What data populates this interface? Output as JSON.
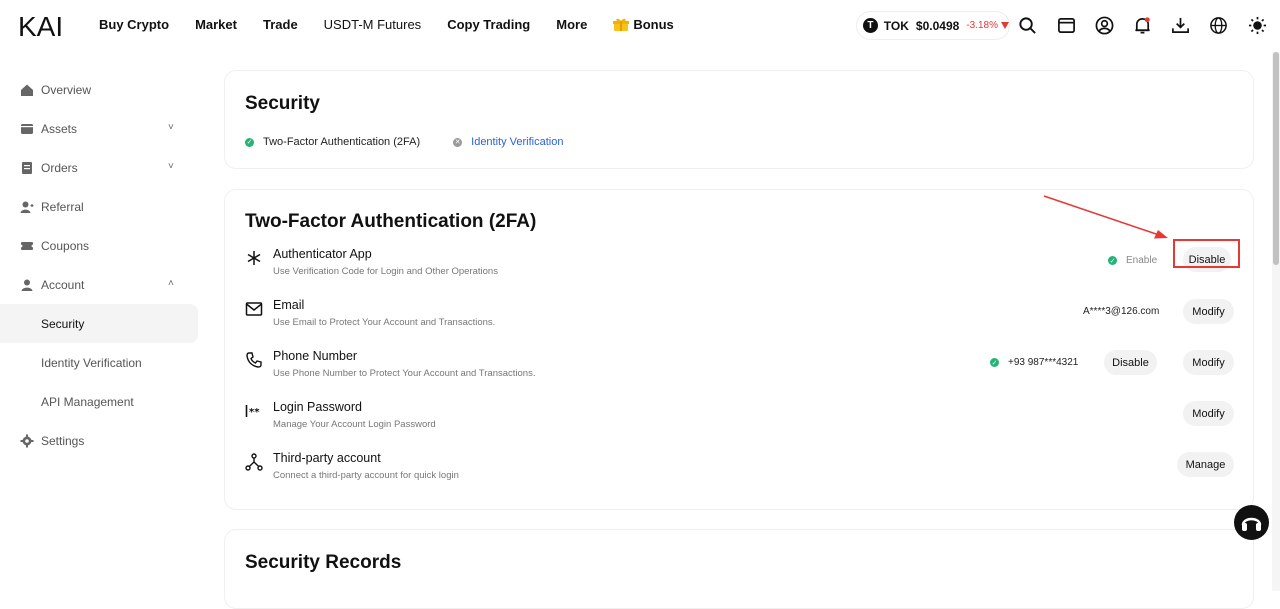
{
  "brand": {
    "logo_text": "KAI"
  },
  "nav": {
    "items": [
      "Buy Crypto",
      "Market",
      "Trade",
      "USDT-M Futures",
      "Copy Trading",
      "More"
    ],
    "bonus_label": "Bonus"
  },
  "ticker": {
    "symbol": "TOK",
    "price": "$0.0498",
    "change": "-3.18%",
    "coin_glyph": "T"
  },
  "header_icons": [
    "search-icon",
    "wallet-icon",
    "user-icon",
    "bell-icon",
    "download-icon",
    "globe-icon",
    "sun-icon"
  ],
  "sidebar": {
    "items": [
      {
        "label": "Overview",
        "icon": "home-icon"
      },
      {
        "label": "Assets",
        "icon": "wallet-icon",
        "chevron": "˅"
      },
      {
        "label": "Orders",
        "icon": "orders-icon",
        "chevron": "˅"
      },
      {
        "label": "Referral",
        "icon": "referral-icon"
      },
      {
        "label": "Coupons",
        "icon": "coupon-icon"
      },
      {
        "label": "Account",
        "icon": "account-icon",
        "chevron": "˄"
      }
    ],
    "account_sub": [
      "Security",
      "Identity Verification",
      "API Management"
    ],
    "settings": {
      "label": "Settings",
      "icon": "gear-icon"
    }
  },
  "security": {
    "title": "Security",
    "badges": {
      "twofa": "Two-Factor Authentication (2FA)",
      "identity": "Identity Verification"
    }
  },
  "twofa": {
    "title": "Two-Factor Authentication (2FA)",
    "rows": [
      {
        "title": "Authenticator App",
        "desc": "Use Verification Code for Login and Other Operations",
        "status": "Enable",
        "button": "Disable"
      },
      {
        "title": "Email",
        "desc": "Use Email to Protect Your Account and Transactions.",
        "value": "A****3@126.com",
        "button": "Modify"
      },
      {
        "title": "Phone Number",
        "desc": "Use Phone Number to Protect Your Account and Transactions.",
        "value": "+93 987***4321",
        "button_secondary": "Disable",
        "button": "Modify"
      },
      {
        "title": "Login Password",
        "desc": "Manage Your Account Login Password",
        "button": "Modify"
      },
      {
        "title": "Third-party account",
        "desc": "Connect a third-party account for quick login",
        "button": "Manage"
      }
    ]
  },
  "records": {
    "title": "Security Records"
  },
  "colors": {
    "accent_red": "#e53935",
    "success": "#22b573",
    "link": "#2a63d4"
  }
}
